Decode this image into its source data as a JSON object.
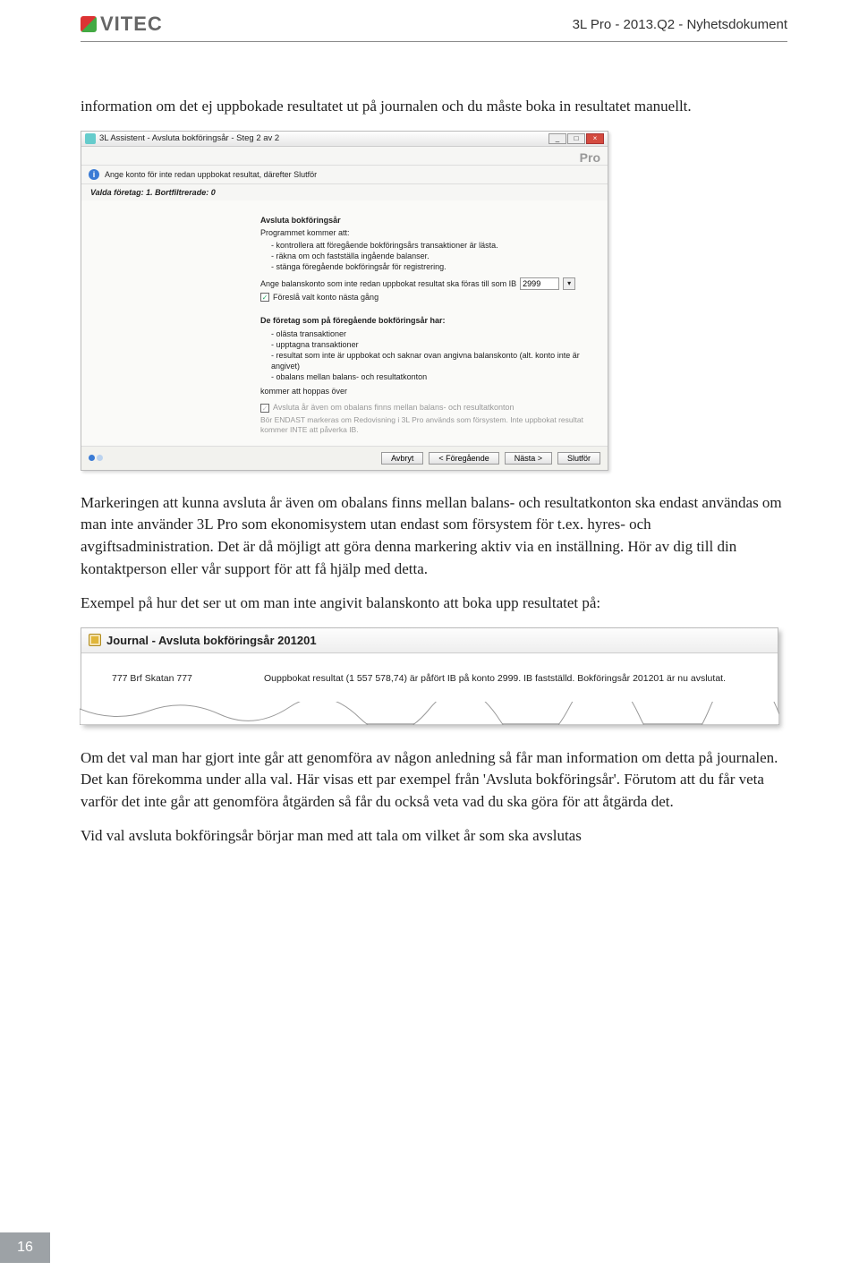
{
  "header": {
    "logo_text": "VITEC",
    "doc_title": "3L Pro - 2013.Q2 - Nyhetsdokument"
  },
  "para1": "information om det ej uppbokade resultatet ut på journalen och du måste boka in resultatet manuellt.",
  "wizard": {
    "title": "3L Assistent - Avsluta bokföringsår - Steg 2 av 2",
    "brand": "Pro",
    "info_line": "Ange konto för inte redan uppbokat resultat, därefter Slutför",
    "sub_line": "Valda företag: 1. Bortfiltrerade: 0",
    "section_a": "Avsluta bokföringsår",
    "program_intro": "Programmet kommer att:",
    "program_items": [
      "kontrollera att föregående bokföringsårs transaktioner är lästa.",
      "räkna om och fastställa ingående balanser.",
      "stänga föregående bokföringsår för registrering."
    ],
    "balance_prompt": "Ange balanskonto som inte redan uppbokat resultat ska föras till som IB",
    "balance_value": "2999",
    "chk_propose": "Föreslå valt konto nästa gång",
    "section_b": "De företag som på föregående bokföringsår har:",
    "sectionb_items": [
      "olästa transaktioner",
      "upptagna transaktioner",
      "resultat som inte är uppbokat och saknar ovan angivna balanskonto (alt. konto inte är angivet)",
      "obalans mellan balans- och resultatkonton"
    ],
    "hop_line": "kommer att hoppas över",
    "chk_close_unbal": "Avsluta år även om obalans finns mellan balans- och resultatkonton",
    "grey_note": "Bör ENDAST markeras om Redovisning i 3L Pro används som försystem. Inte uppbokat resultat kommer INTE att påverka IB.",
    "btn_cancel": "Avbryt",
    "btn_prev": "< Föregående",
    "btn_next": "Nästa >",
    "btn_finish": "Slutför"
  },
  "para2": "Markeringen att kunna avsluta år även om obalans finns mellan balans- och resultatkonton ska endast användas om man inte använder 3L Pro som ekonomisystem utan endast som försystem för t.ex. hyres- och avgiftsadministration. Det är då möjligt att göra denna markering aktiv via en inställning. Hör av dig till din kontaktperson eller vår support för att få hjälp med detta.",
  "para3": "Exempel på hur det ser ut om man inte angivit balanskonto att boka upp resultatet på:",
  "journal": {
    "title": "Journal - Avsluta bokföringsår 201201",
    "col1": "777 Brf Skatan 777",
    "col2": "Ouppbokat resultat (1 557 578,74) är påfört IB på konto 2999. IB fastställd. Bokföringsår 201201 är nu avslutat."
  },
  "para4": "Om det val man har gjort inte går att genomföra av någon anledning så får man information om detta på journalen. Det kan förekomma under alla val. Här visas ett par exempel från 'Avsluta bokföringsår'. Förutom att du får veta varför det inte går att genomföra åtgärden så får du också veta vad du ska göra för att åtgärda det.",
  "para5": "Vid val avsluta bokföringsår börjar man med att tala om vilket år som ska avslutas",
  "page_number": "16"
}
